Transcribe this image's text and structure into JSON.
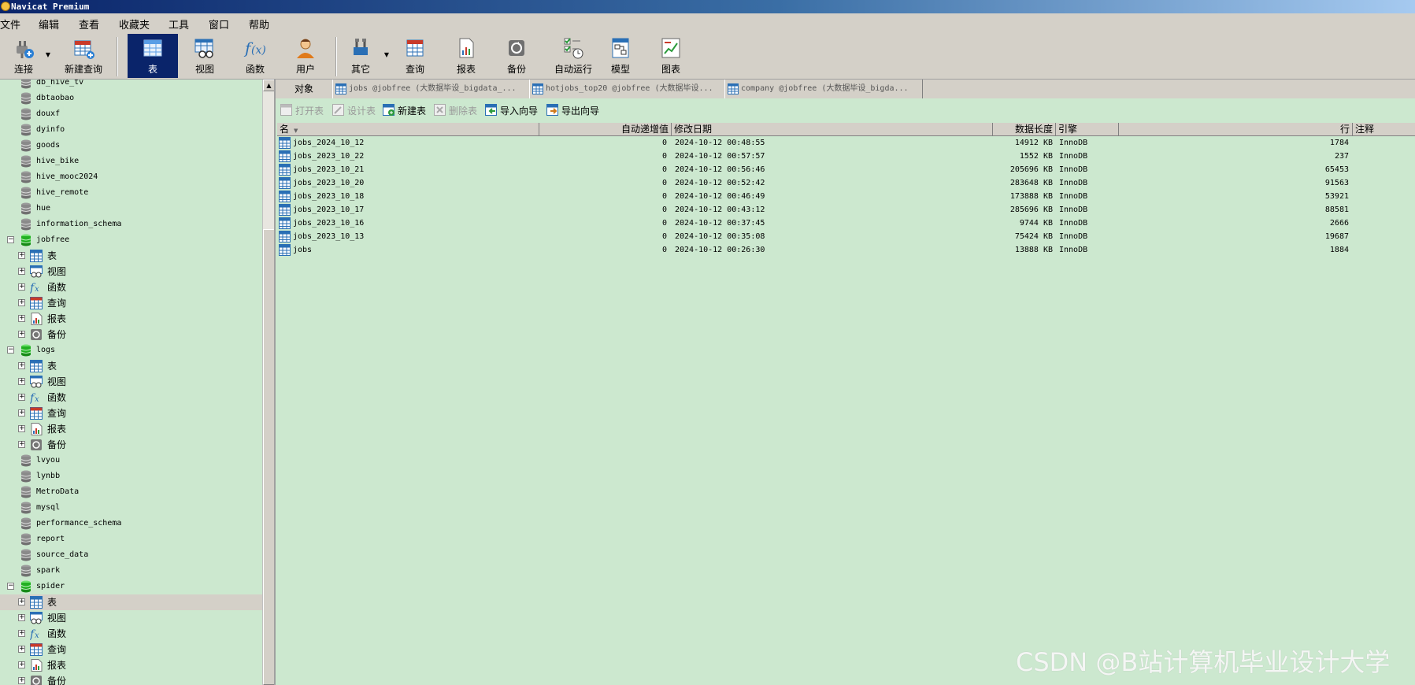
{
  "window": {
    "title": "Navicat Premium"
  },
  "menu": [
    "文件",
    "编辑",
    "查看",
    "收藏夹",
    "工具",
    "窗口",
    "帮助"
  ],
  "toolbar": {
    "connect": "连接",
    "new_query": "新建查询",
    "table": "表",
    "view": "视图",
    "function": "函数",
    "user": "用户",
    "other": "其它",
    "query": "查询",
    "report": "报表",
    "backup": "备份",
    "autorun": "自动运行",
    "model": "模型",
    "chart": "图表"
  },
  "tree": [
    {
      "label": "db_hive_tv",
      "type": "db"
    },
    {
      "label": "dbtaobao",
      "type": "db"
    },
    {
      "label": "douxf",
      "type": "db"
    },
    {
      "label": "dyinfo",
      "type": "db"
    },
    {
      "label": "goods",
      "type": "db"
    },
    {
      "label": "hive_bike",
      "type": "db"
    },
    {
      "label": "hive_mooc2024",
      "type": "db"
    },
    {
      "label": "hive_remote",
      "type": "db"
    },
    {
      "label": "hue",
      "type": "db"
    },
    {
      "label": "information_schema",
      "type": "db"
    },
    {
      "label": "jobfree",
      "type": "db-open"
    },
    {
      "label": "表",
      "type": "table"
    },
    {
      "label": "视图",
      "type": "view"
    },
    {
      "label": "函数",
      "type": "func"
    },
    {
      "label": "查询",
      "type": "query"
    },
    {
      "label": "报表",
      "type": "report"
    },
    {
      "label": "备份",
      "type": "backup"
    },
    {
      "label": "logs",
      "type": "db-open"
    },
    {
      "label": "表",
      "type": "table"
    },
    {
      "label": "视图",
      "type": "view"
    },
    {
      "label": "函数",
      "type": "func"
    },
    {
      "label": "查询",
      "type": "query"
    },
    {
      "label": "报表",
      "type": "report"
    },
    {
      "label": "备份",
      "type": "backup"
    },
    {
      "label": "lvyou",
      "type": "db"
    },
    {
      "label": "lynbb",
      "type": "db"
    },
    {
      "label": "MetroData",
      "type": "db"
    },
    {
      "label": "mysql",
      "type": "db"
    },
    {
      "label": "performance_schema",
      "type": "db"
    },
    {
      "label": "report",
      "type": "db"
    },
    {
      "label": "source_data",
      "type": "db"
    },
    {
      "label": "spark",
      "type": "db"
    },
    {
      "label": "spider",
      "type": "db-open"
    },
    {
      "label": "表",
      "type": "table",
      "selected": true
    },
    {
      "label": "视图",
      "type": "view"
    },
    {
      "label": "函数",
      "type": "func"
    },
    {
      "label": "查询",
      "type": "query"
    },
    {
      "label": "报表",
      "type": "report"
    },
    {
      "label": "备份",
      "type": "backup"
    }
  ],
  "tabs": {
    "object": "对象",
    "docs": [
      "jobs @jobfree (大数据毕设_bigdata_...",
      "hotjobs_top20 @jobfree (大数据毕设...",
      "company @jobfree (大数据毕设_bigda..."
    ]
  },
  "objbar": {
    "open_table": "打开表",
    "design_table": "设计表",
    "new_table": "新建表",
    "delete_table": "删除表",
    "import_wizard": "导入向导",
    "export_wizard": "导出向导"
  },
  "grid": {
    "columns": [
      "名",
      "自动递增值",
      "修改日期",
      "数据长度",
      "引擎",
      "行",
      "注释"
    ],
    "rows": [
      {
        "name": "jobs_2024_10_12",
        "auto_inc": "0",
        "modified": "2024-10-12 00:48:55",
        "size": "14912 KB",
        "engine": "InnoDB",
        "rows": "1784"
      },
      {
        "name": "jobs_2023_10_22",
        "auto_inc": "0",
        "modified": "2024-10-12 00:57:57",
        "size": "1552 KB",
        "engine": "InnoDB",
        "rows": "237"
      },
      {
        "name": "jobs_2023_10_21",
        "auto_inc": "0",
        "modified": "2024-10-12 00:56:46",
        "size": "205696 KB",
        "engine": "InnoDB",
        "rows": "65453"
      },
      {
        "name": "jobs_2023_10_20",
        "auto_inc": "0",
        "modified": "2024-10-12 00:52:42",
        "size": "283648 KB",
        "engine": "InnoDB",
        "rows": "91563"
      },
      {
        "name": "jobs_2023_10_18",
        "auto_inc": "0",
        "modified": "2024-10-12 00:46:49",
        "size": "173888 KB",
        "engine": "InnoDB",
        "rows": "53921"
      },
      {
        "name": "jobs_2023_10_17",
        "auto_inc": "0",
        "modified": "2024-10-12 00:43:12",
        "size": "285696 KB",
        "engine": "InnoDB",
        "rows": "88581"
      },
      {
        "name": "jobs_2023_10_16",
        "auto_inc": "0",
        "modified": "2024-10-12 00:37:45",
        "size": "9744 KB",
        "engine": "InnoDB",
        "rows": "2666"
      },
      {
        "name": "jobs_2023_10_13",
        "auto_inc": "0",
        "modified": "2024-10-12 00:35:08",
        "size": "75424 KB",
        "engine": "InnoDB",
        "rows": "19687"
      },
      {
        "name": "jobs",
        "auto_inc": "0",
        "modified": "2024-10-12 00:26:30",
        "size": "13888 KB",
        "engine": "InnoDB",
        "rows": "1884"
      }
    ]
  },
  "watermark": "CSDN @B站计算机毕业设计大学"
}
